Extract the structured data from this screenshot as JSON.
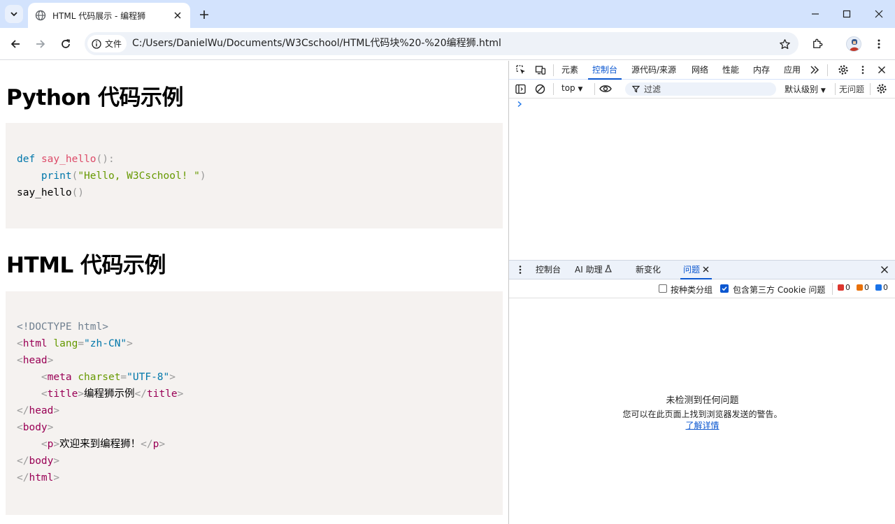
{
  "browser": {
    "tab_title": "HTML 代码展示 - 编程狮",
    "url_chip": "文件",
    "url": "C:/Users/DanielWu/Documents/W3Cschool/HTML代码块%20-%20编程狮.html"
  },
  "page": {
    "python_heading": "Python 代码示例",
    "html_heading": "HTML 代码示例",
    "python_code": {
      "l1_def": "def",
      "l1_fn": "say_hello",
      "l1_pun": "():",
      "l2_fn": "print",
      "l2_str": "\"Hello, W3Cschool! \"",
      "l3_name": "say_hello"
    },
    "html_code": {
      "doctype": "<!DOCTYPE html>",
      "html_lang_value": "\"zh-CN\"",
      "meta_charset_value": "\"UTF-8\"",
      "title_text": "编程狮示例",
      "p_text": "欢迎来到编程狮！"
    }
  },
  "devtools": {
    "tabs": [
      "元素",
      "控制台",
      "源代码/来源",
      "网络",
      "性能",
      "内存",
      "应用"
    ],
    "active_tab": "控制台",
    "context": "top",
    "filter_placeholder": "过滤",
    "levels": "默认级别",
    "no_issues": "无问题",
    "drawer_tabs": [
      "控制台",
      "AI 助理",
      "新变化",
      "问题"
    ],
    "active_drawer_tab": "问题",
    "group_by_kind": "按种类分组",
    "include_third_party": "包含第三方 Cookie 问题",
    "counts": {
      "errors": "0",
      "warnings": "0",
      "info": "0"
    },
    "empty_title": "未检测到任何问题",
    "empty_desc": "您可以在此页面上找到浏览器发送的警告。",
    "learn_more": "了解详情"
  },
  "colors": {
    "accent": "#0b57d0",
    "tabstrip": "#d3e3fd",
    "code_bg": "#f5f2f0"
  }
}
